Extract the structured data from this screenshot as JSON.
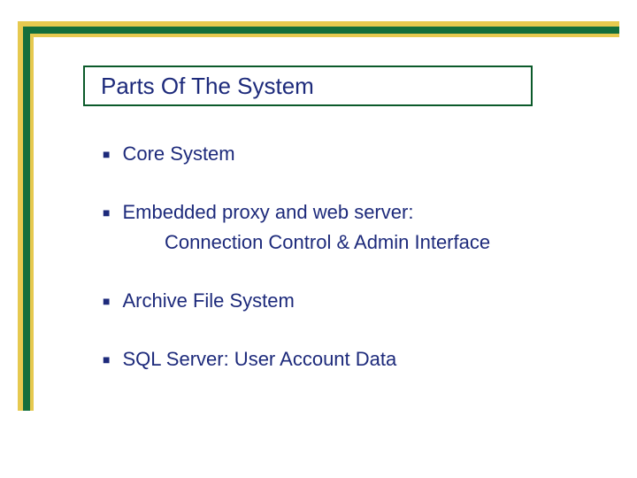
{
  "title": "Parts Of The System",
  "bullets": {
    "b0": "Core System",
    "b1": "Embedded proxy and web server:",
    "b1_sub": "Connection Control & Admin Interface",
    "b2": "Archive File System",
    "b3": "SQL Server:  User Account Data"
  }
}
